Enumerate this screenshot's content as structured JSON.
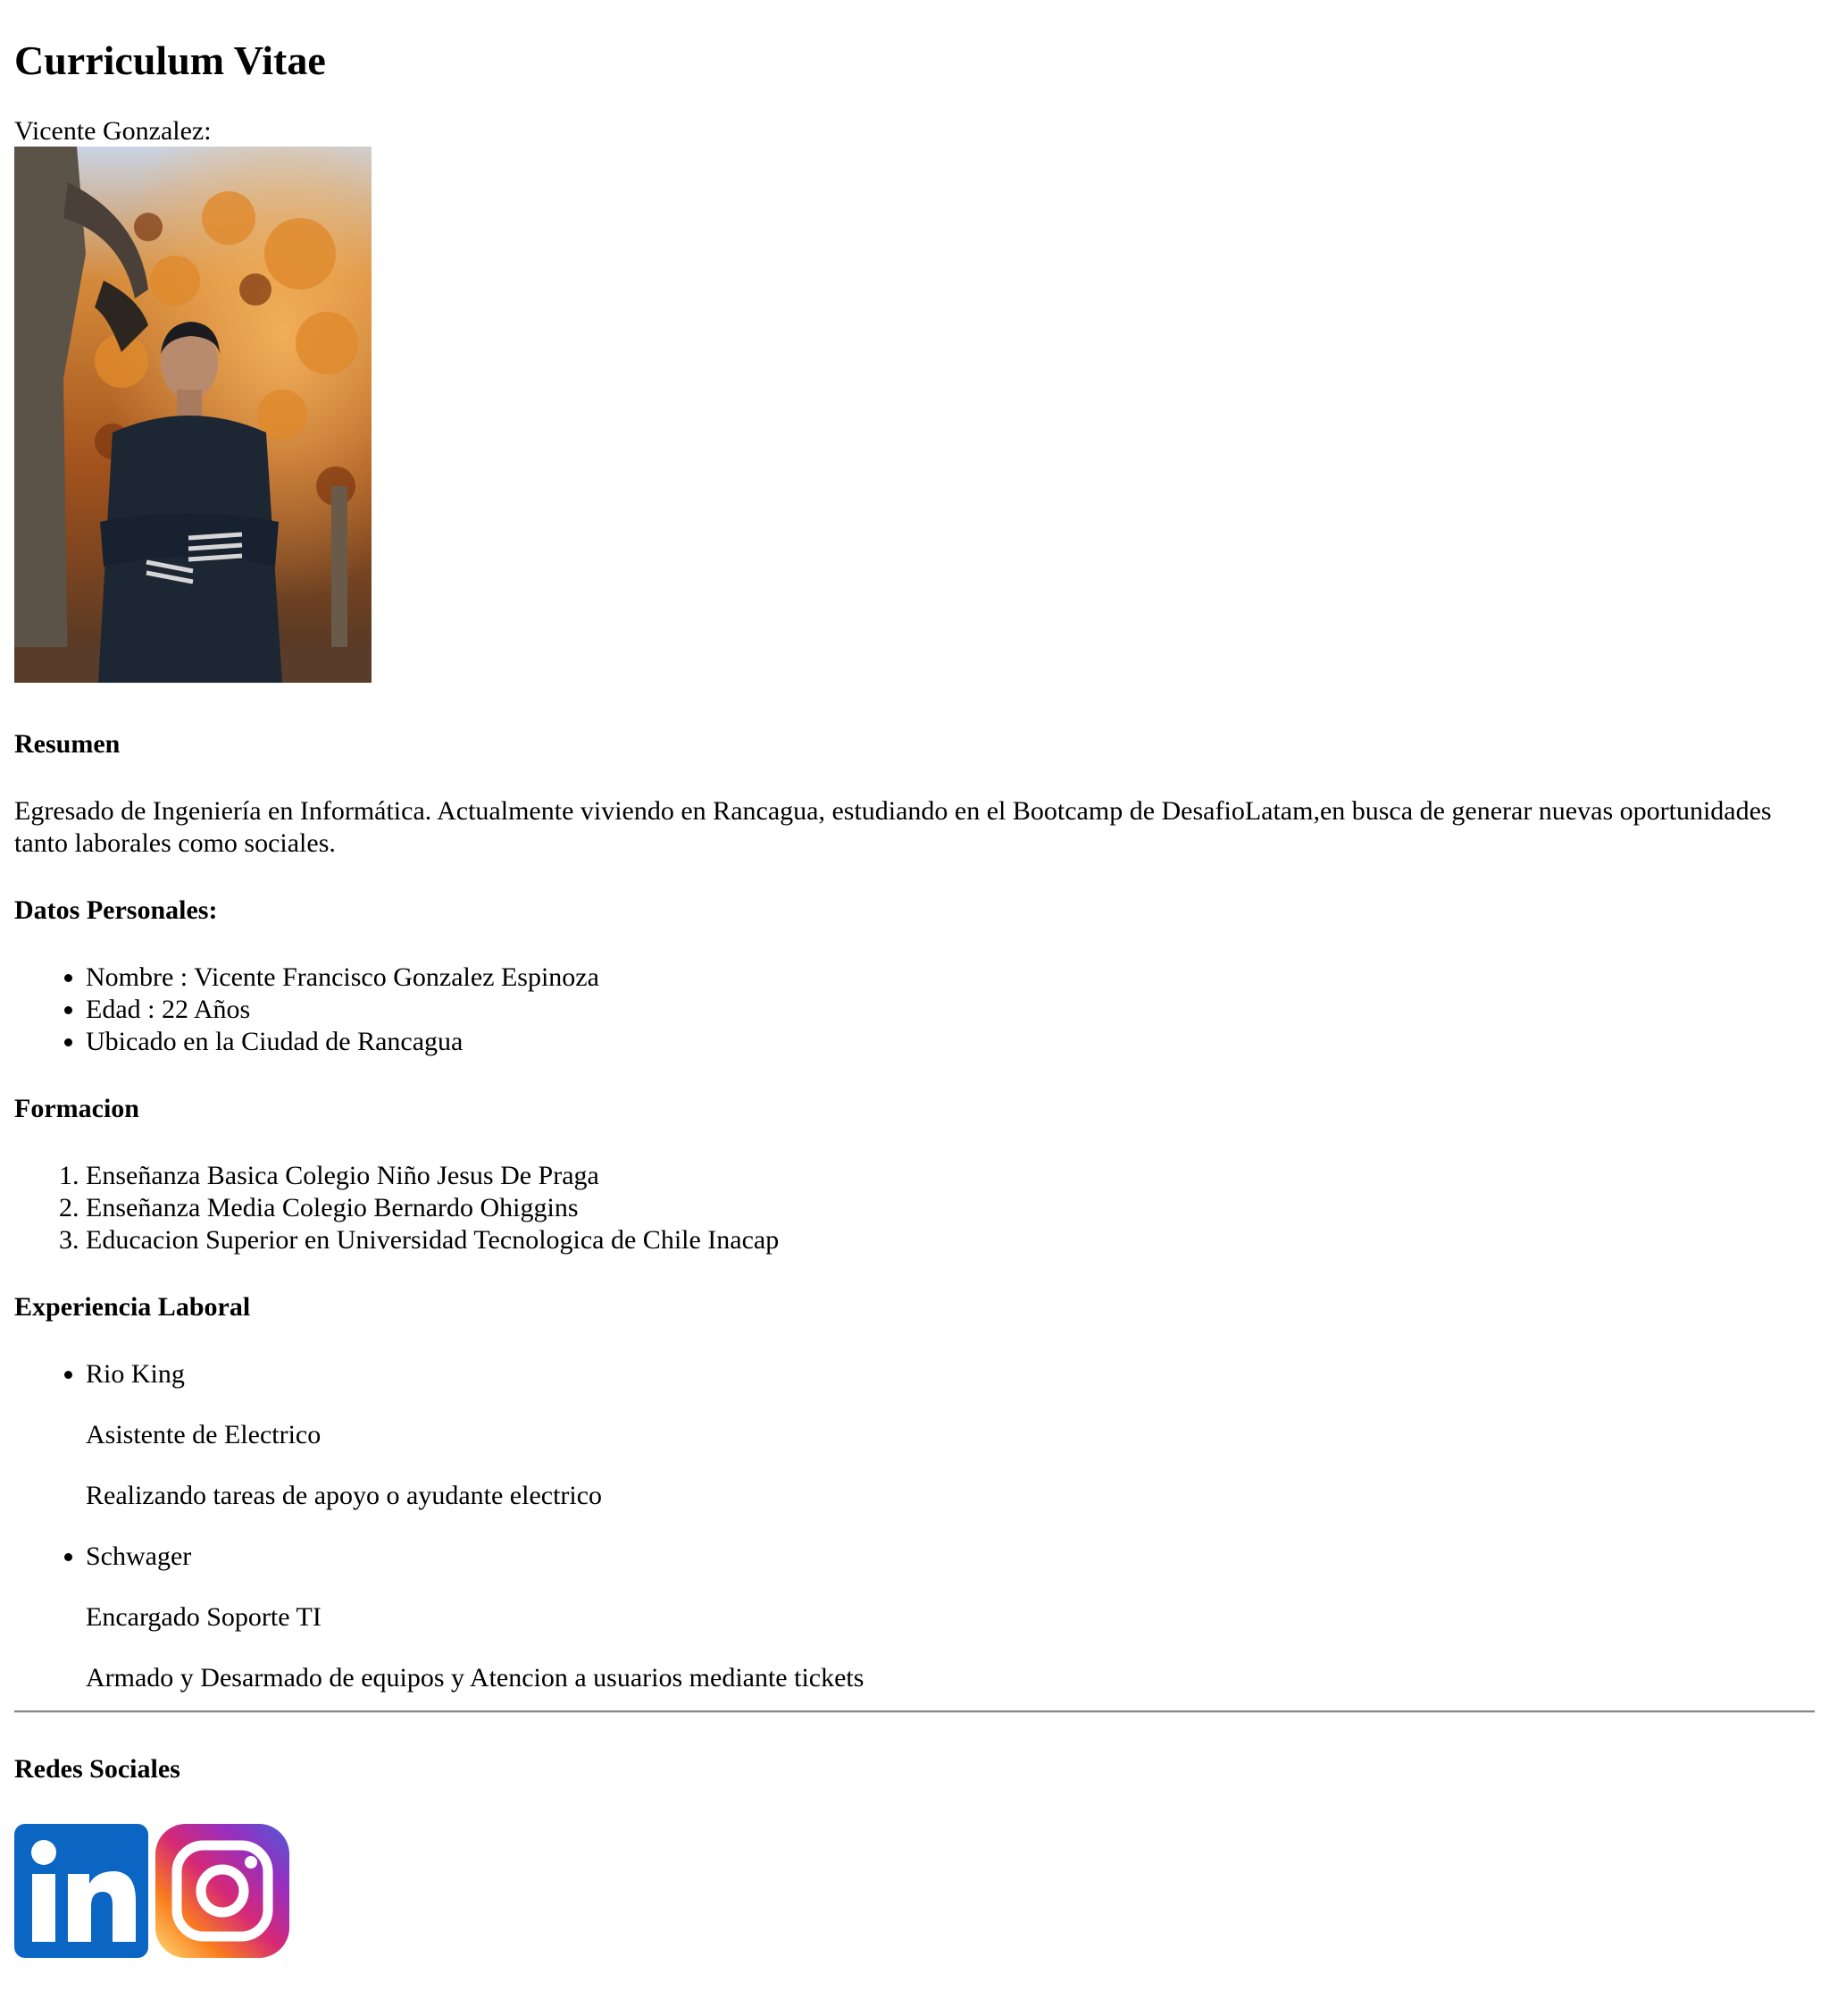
{
  "header": {
    "title": "Curriculum Vitae"
  },
  "profile": {
    "name_label": "Vicente Gonzalez:"
  },
  "resumen": {
    "heading": "Resumen",
    "text": "Egresado de Ingeniería en Informática. Actualmente viviendo en Rancagua, estudiando en el Bootcamp de DesafioLatam,en busca de generar nuevas oportunidades tanto laborales como sociales."
  },
  "datos": {
    "heading": "Datos Personales:",
    "items": [
      "Nombre : Vicente Francisco Gonzalez Espinoza",
      "Edad : 22 Años",
      "Ubicado en la Ciudad de Rancagua"
    ]
  },
  "formacion": {
    "heading": "Formacion",
    "items": [
      "Enseñanza Basica Colegio Niño Jesus De Praga",
      "Enseñanza Media Colegio Bernardo Ohiggins",
      "Educacion Superior en Universidad Tecnologica de Chile Inacap"
    ]
  },
  "experiencia": {
    "heading": "Experiencia Laboral",
    "jobs": [
      {
        "company": "Rio King",
        "role": "Asistente de Electrico",
        "description": "Realizando tareas de apoyo o ayudante electrico"
      },
      {
        "company": "Schwager",
        "role": "Encargado Soporte TI",
        "description": "Armado y Desarmado de equipos y Atencion a usuarios mediante tickets"
      }
    ]
  },
  "redes": {
    "heading": "Redes Sociales",
    "icons": [
      "linkedin-icon",
      "instagram-icon"
    ]
  },
  "colors": {
    "linkedin": "#0a66c2",
    "hr": "#8a8a8a"
  }
}
